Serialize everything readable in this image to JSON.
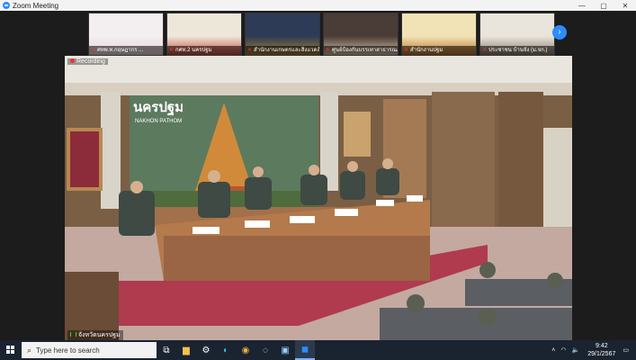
{
  "window": {
    "title": "Zoom Meeting",
    "min": "—",
    "max": "▢",
    "close": "✕"
  },
  "participants": [
    {
      "name": "ศทพ.ท.กฤษฎากร ...",
      "colors": [
        "#f3eef0",
        "#e8d4d8"
      ]
    },
    {
      "name": "กศท.2 นครปฐม",
      "colors": [
        "#ede7da",
        "#c84b3b"
      ]
    },
    {
      "name": "สำนักงานเกษตรและสิ่งแวดล้อม",
      "colors": [
        "#2e3b57",
        "#a57f32"
      ]
    },
    {
      "name": "ศูนย์ป้องกันบรรเทาสาธารณภัย",
      "colors": [
        "#4a3c37",
        "#d8c4a6"
      ]
    },
    {
      "name": "สำนักงานปฐม",
      "colors": [
        "#f1e3b5",
        "#b8722a"
      ]
    },
    {
      "name": "ประชาชน บ้านจัง (ม.จก.)",
      "colors": [
        "#e9e4dc",
        "#8c7d6a"
      ]
    }
  ],
  "recording_label": "Recording",
  "main_video_label": "จังหวัดนครปฐม",
  "scene_text": {
    "sign_thai": "นครปฐม",
    "sign_en": "NAKHON PATHOM"
  },
  "taskbar": {
    "search_placeholder": "Type here to search",
    "time": "9:42",
    "date": "29/1/2567"
  }
}
